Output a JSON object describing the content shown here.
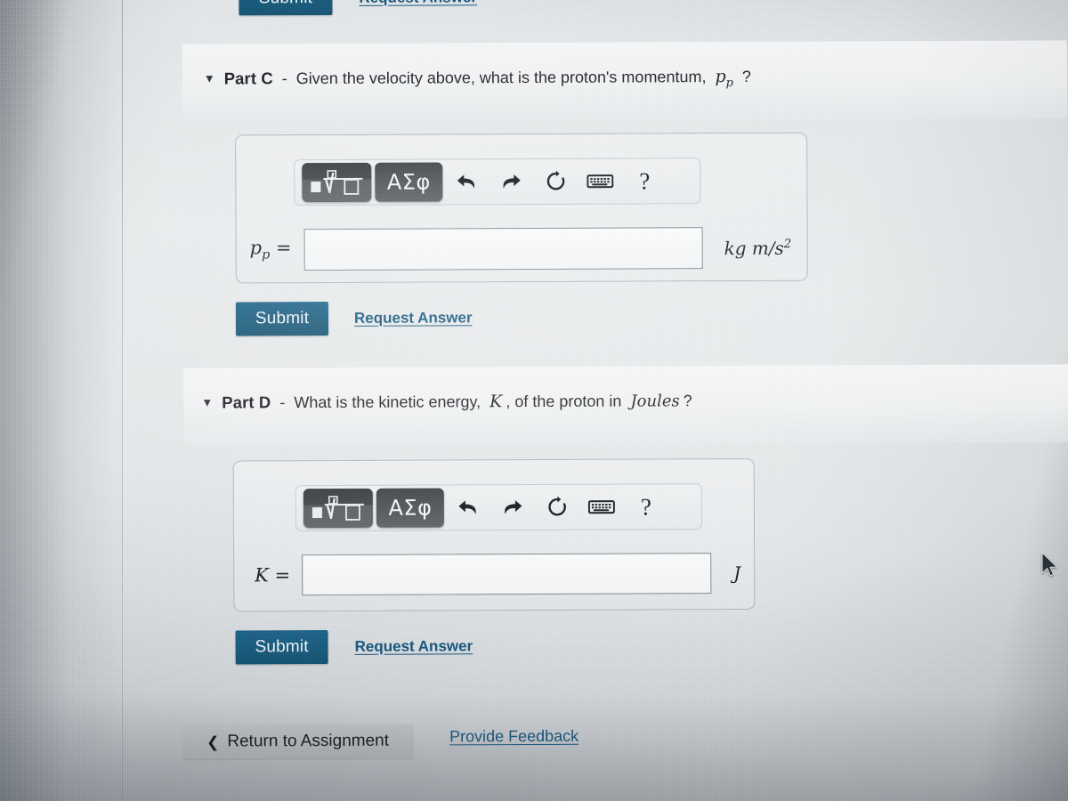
{
  "previous_part": {
    "submit_label": "Submit",
    "request_answer_label": "Request Answer"
  },
  "parts": [
    {
      "id": "part-c",
      "caret": "▼",
      "label": "Part C",
      "dash": "-",
      "question": "Given the velocity above, what is the proton's momentum,",
      "question_symbol": "p",
      "question_symbol_sub": "p",
      "question_end": "?",
      "toolbar": {
        "template_button": "math-template",
        "greek_button": "ΑΣφ",
        "undo": "undo",
        "redo": "redo",
        "reset": "reset",
        "keyboard": "keyboard",
        "help": "?"
      },
      "answer": {
        "variable": "p",
        "variable_sub": "p",
        "equals": "=",
        "value": "",
        "placeholder": "",
        "unit_main": "kg m/s",
        "unit_exponent": "2"
      },
      "submit_label": "Submit",
      "request_answer_label": "Request Answer"
    },
    {
      "id": "part-d",
      "caret": "▼",
      "label": "Part D",
      "dash": "-",
      "question_pre": "What is the kinetic energy,",
      "question_symbol": "K",
      "question_mid": ", of the proton in",
      "question_unit_word": "Joules",
      "question_end": "?",
      "toolbar": {
        "template_button": "math-template",
        "greek_button": "ΑΣφ",
        "undo": "undo",
        "redo": "redo",
        "reset": "reset",
        "keyboard": "keyboard",
        "help": "?"
      },
      "answer": {
        "variable": "K",
        "equals": "=",
        "value": "",
        "placeholder": "",
        "unit_main": "J",
        "unit_exponent": ""
      },
      "submit_label": "Submit",
      "request_answer_label": "Request Answer"
    }
  ],
  "footer": {
    "return_chevron": "❮",
    "return_label": "Return to Assignment",
    "feedback_label": "Provide Feedback"
  },
  "colors": {
    "submit_blue": "#1a5a7b",
    "link_blue": "#15547a",
    "toolbar_key_dark": "#43474c",
    "page_bg": "#e7eaeb",
    "return_gray": "#bcc1c5"
  }
}
